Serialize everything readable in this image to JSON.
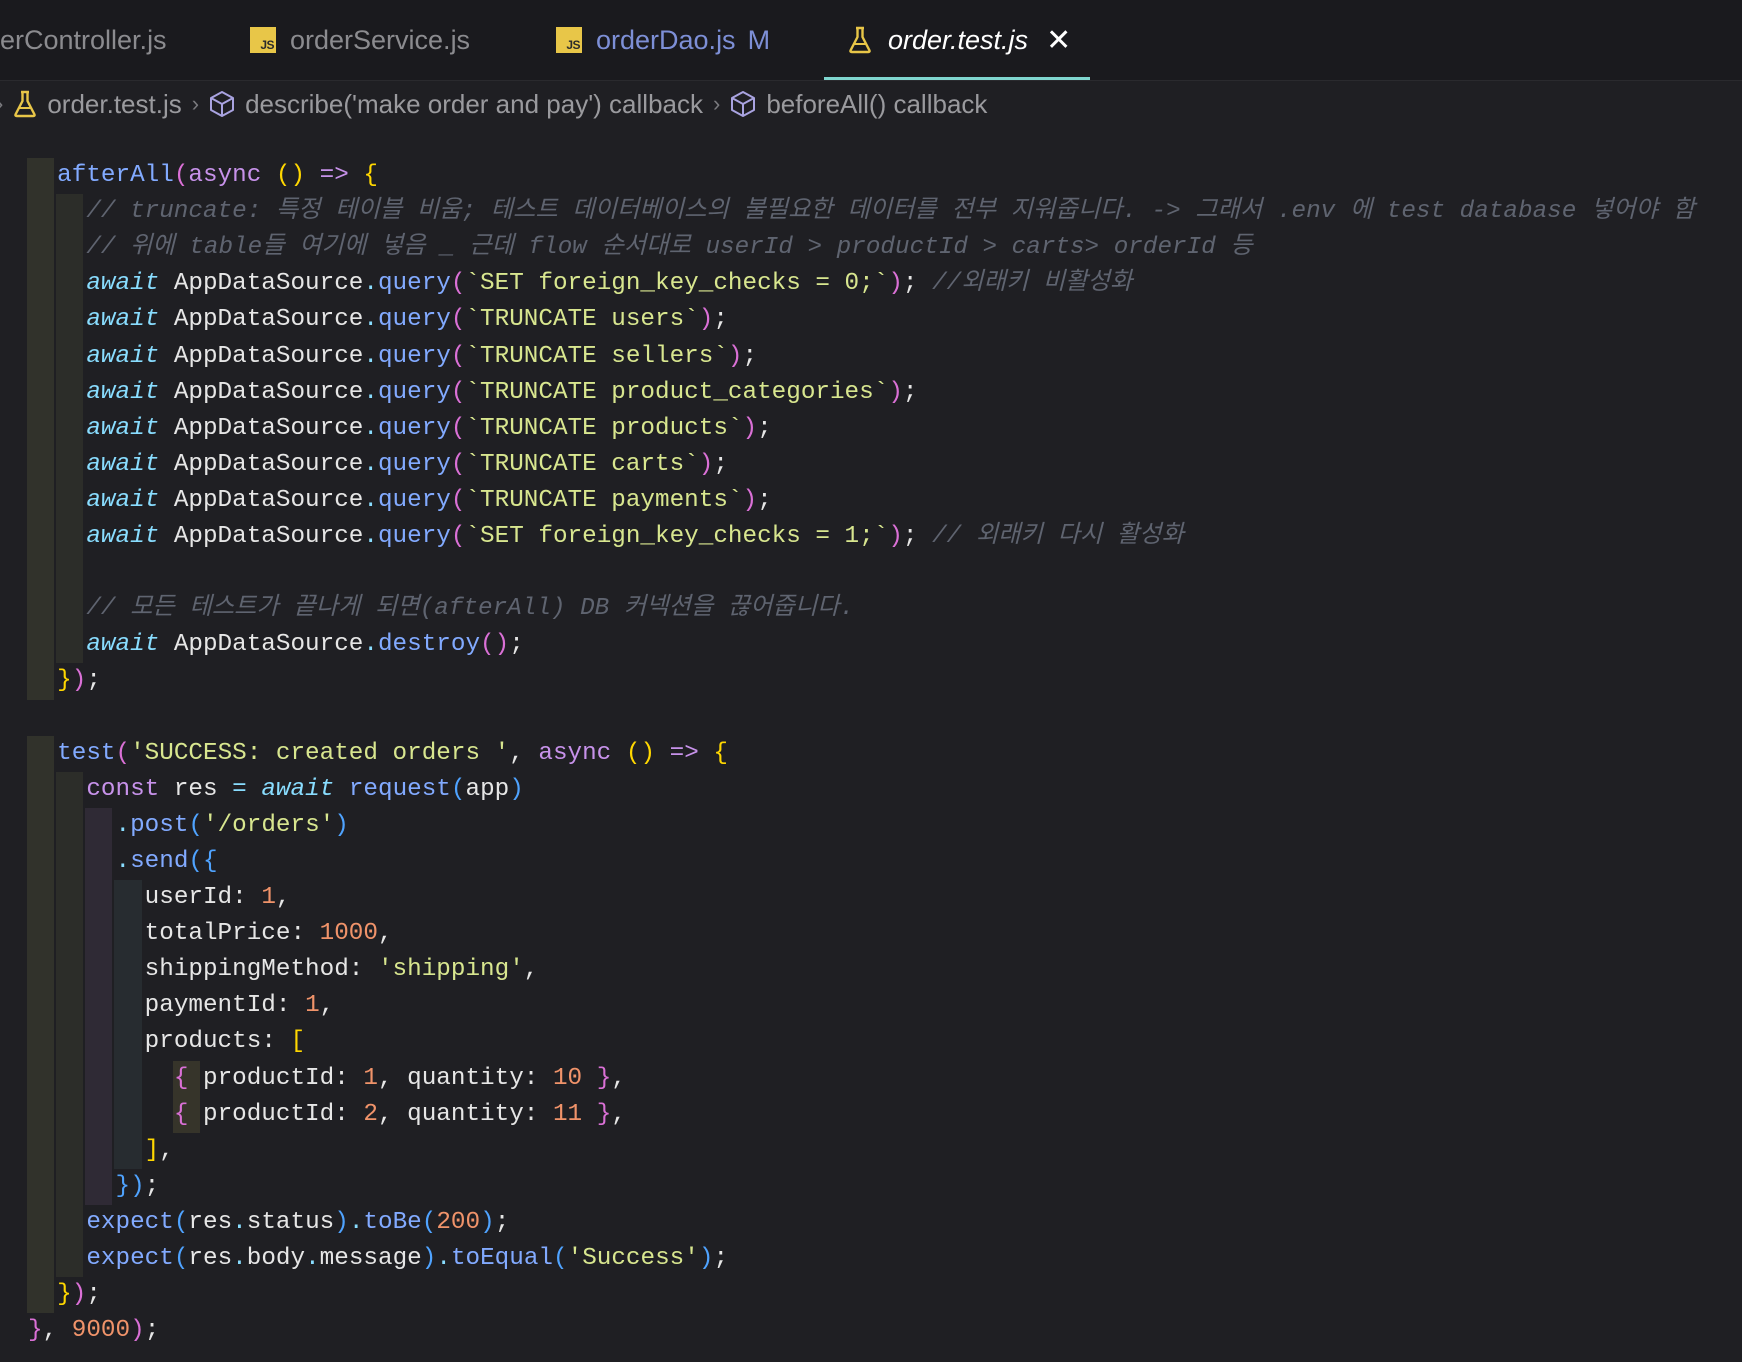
{
  "tabs": [
    {
      "label": "erController.js"
    },
    {
      "label": "orderService.js"
    },
    {
      "label": "orderDao.js",
      "badge": "M"
    },
    {
      "label": "order.test.js",
      "active": true
    }
  ],
  "breadcrumb": [
    "order.test.js",
    "describe('make order and pay') callback",
    "beforeAll() callback"
  ],
  "colors": {
    "accent": "#7fd6cf",
    "js_icon": "#e8c648",
    "modified": "#7d8fd6"
  },
  "code": [
    [
      [
        "  ",
        "id"
      ],
      [
        "afterAll",
        "fn"
      ],
      [
        "(",
        "p2"
      ],
      [
        "async",
        "kw"
      ],
      [
        " ",
        "id"
      ],
      [
        "()",
        "p1"
      ],
      [
        " => ",
        "kw"
      ],
      [
        "{",
        "p1"
      ]
    ],
    [
      [
        "    ",
        "id"
      ],
      [
        "// truncate: 특정 테이블 비움; 테스트 데이터베이스의 불필요한 데이터를 전부 지워줍니다. -> 그래서 .env 에 test database 넣어야 함",
        "cm"
      ]
    ],
    [
      [
        "    ",
        "id"
      ],
      [
        "// 위에 table들 여기에 넣음 _ 근데 flow 순서대로 userId > productId > carts> orderId 등",
        "cm"
      ]
    ],
    [
      [
        "    ",
        "id"
      ],
      [
        "await",
        "kwi"
      ],
      [
        " AppDataSource",
        "id"
      ],
      [
        ".",
        "op"
      ],
      [
        "query",
        "fn"
      ],
      [
        "(",
        "p2"
      ],
      [
        "`SET foreign_key_checks = 0;`",
        "str"
      ],
      [
        ")",
        "p2"
      ],
      [
        ";",
        "id"
      ],
      [
        " //외래키 비활성화",
        "cm"
      ]
    ],
    [
      [
        "    ",
        "id"
      ],
      [
        "await",
        "kwi"
      ],
      [
        " AppDataSource",
        "id"
      ],
      [
        ".",
        "op"
      ],
      [
        "query",
        "fn"
      ],
      [
        "(",
        "p2"
      ],
      [
        "`TRUNCATE users`",
        "str"
      ],
      [
        ")",
        "p2"
      ],
      [
        ";",
        "id"
      ]
    ],
    [
      [
        "    ",
        "id"
      ],
      [
        "await",
        "kwi"
      ],
      [
        " AppDataSource",
        "id"
      ],
      [
        ".",
        "op"
      ],
      [
        "query",
        "fn"
      ],
      [
        "(",
        "p2"
      ],
      [
        "`TRUNCATE sellers`",
        "str"
      ],
      [
        ")",
        "p2"
      ],
      [
        ";",
        "id"
      ]
    ],
    [
      [
        "    ",
        "id"
      ],
      [
        "await",
        "kwi"
      ],
      [
        " AppDataSource",
        "id"
      ],
      [
        ".",
        "op"
      ],
      [
        "query",
        "fn"
      ],
      [
        "(",
        "p2"
      ],
      [
        "`TRUNCATE product_categories`",
        "str"
      ],
      [
        ")",
        "p2"
      ],
      [
        ";",
        "id"
      ]
    ],
    [
      [
        "    ",
        "id"
      ],
      [
        "await",
        "kwi"
      ],
      [
        " AppDataSource",
        "id"
      ],
      [
        ".",
        "op"
      ],
      [
        "query",
        "fn"
      ],
      [
        "(",
        "p2"
      ],
      [
        "`TRUNCATE products`",
        "str"
      ],
      [
        ")",
        "p2"
      ],
      [
        ";",
        "id"
      ]
    ],
    [
      [
        "    ",
        "id"
      ],
      [
        "await",
        "kwi"
      ],
      [
        " AppDataSource",
        "id"
      ],
      [
        ".",
        "op"
      ],
      [
        "query",
        "fn"
      ],
      [
        "(",
        "p2"
      ],
      [
        "`TRUNCATE carts`",
        "str"
      ],
      [
        ")",
        "p2"
      ],
      [
        ";",
        "id"
      ]
    ],
    [
      [
        "    ",
        "id"
      ],
      [
        "await",
        "kwi"
      ],
      [
        " AppDataSource",
        "id"
      ],
      [
        ".",
        "op"
      ],
      [
        "query",
        "fn"
      ],
      [
        "(",
        "p2"
      ],
      [
        "`TRUNCATE payments`",
        "str"
      ],
      [
        ")",
        "p2"
      ],
      [
        ";",
        "id"
      ]
    ],
    [
      [
        "    ",
        "id"
      ],
      [
        "await",
        "kwi"
      ],
      [
        " AppDataSource",
        "id"
      ],
      [
        ".",
        "op"
      ],
      [
        "query",
        "fn"
      ],
      [
        "(",
        "p2"
      ],
      [
        "`SET foreign_key_checks = 1;`",
        "str"
      ],
      [
        ")",
        "p2"
      ],
      [
        ";",
        "id"
      ],
      [
        " // 외래키 다시 활성화",
        "cm"
      ]
    ],
    [],
    [
      [
        "    ",
        "id"
      ],
      [
        "// 모든 테스트가 끝나게 되면(afterAll) DB 커넥션을 끊어줍니다.",
        "cm"
      ]
    ],
    [
      [
        "    ",
        "id"
      ],
      [
        "await",
        "kwi"
      ],
      [
        " AppDataSource",
        "id"
      ],
      [
        ".",
        "op"
      ],
      [
        "destroy",
        "fn"
      ],
      [
        "()",
        "p2"
      ],
      [
        ";",
        "id"
      ]
    ],
    [
      [
        "  ",
        "id"
      ],
      [
        "}",
        "p1"
      ],
      [
        ")",
        "p2"
      ],
      [
        ";",
        "id"
      ]
    ],
    [],
    [
      [
        "  ",
        "id"
      ],
      [
        "test",
        "fn"
      ],
      [
        "(",
        "p2"
      ],
      [
        "'SUCCESS: created orders '",
        "str"
      ],
      [
        ", ",
        "id"
      ],
      [
        "async",
        "kw"
      ],
      [
        " ",
        "id"
      ],
      [
        "()",
        "p1"
      ],
      [
        " => ",
        "kw"
      ],
      [
        "{",
        "p1"
      ]
    ],
    [
      [
        "    ",
        "id"
      ],
      [
        "const",
        "kw"
      ],
      [
        " res ",
        "id"
      ],
      [
        "=",
        "op"
      ],
      [
        " ",
        "id"
      ],
      [
        "await",
        "kwi"
      ],
      [
        " ",
        "id"
      ],
      [
        "request",
        "fn"
      ],
      [
        "(",
        "p3"
      ],
      [
        "app",
        "id"
      ],
      [
        ")",
        "p3"
      ]
    ],
    [
      [
        "      ",
        "id"
      ],
      [
        ".",
        "op"
      ],
      [
        "post",
        "fn"
      ],
      [
        "(",
        "p3"
      ],
      [
        "'/orders'",
        "str"
      ],
      [
        ")",
        "p3"
      ]
    ],
    [
      [
        "      ",
        "id"
      ],
      [
        ".",
        "op"
      ],
      [
        "send",
        "fn"
      ],
      [
        "(",
        "p3"
      ],
      [
        "{",
        "p3"
      ]
    ],
    [
      [
        "        ",
        "id"
      ],
      [
        "userId",
        "id"
      ],
      [
        ": ",
        "id"
      ],
      [
        "1",
        "num"
      ],
      [
        ",",
        "id"
      ]
    ],
    [
      [
        "        ",
        "id"
      ],
      [
        "totalPrice",
        "id"
      ],
      [
        ": ",
        "id"
      ],
      [
        "1000",
        "num"
      ],
      [
        ",",
        "id"
      ]
    ],
    [
      [
        "        ",
        "id"
      ],
      [
        "shippingMethod",
        "id"
      ],
      [
        ": ",
        "id"
      ],
      [
        "'shipping'",
        "str"
      ],
      [
        ",",
        "id"
      ]
    ],
    [
      [
        "        ",
        "id"
      ],
      [
        "paymentId",
        "id"
      ],
      [
        ": ",
        "id"
      ],
      [
        "1",
        "num"
      ],
      [
        ",",
        "id"
      ]
    ],
    [
      [
        "        ",
        "id"
      ],
      [
        "products",
        "id"
      ],
      [
        ": ",
        "id"
      ],
      [
        "[",
        "p1"
      ]
    ],
    [
      [
        "          ",
        "id"
      ],
      [
        "{",
        "p2"
      ],
      [
        " productId",
        "id"
      ],
      [
        ": ",
        "id"
      ],
      [
        "1",
        "num"
      ],
      [
        ", quantity",
        "id"
      ],
      [
        ": ",
        "id"
      ],
      [
        "10",
        "num"
      ],
      [
        " ",
        "id"
      ],
      [
        "}",
        "p2"
      ],
      [
        ",",
        "id"
      ]
    ],
    [
      [
        "          ",
        "id"
      ],
      [
        "{",
        "p2"
      ],
      [
        " productId",
        "id"
      ],
      [
        ": ",
        "id"
      ],
      [
        "2",
        "num"
      ],
      [
        ", quantity",
        "id"
      ],
      [
        ": ",
        "id"
      ],
      [
        "11",
        "num"
      ],
      [
        " ",
        "id"
      ],
      [
        "}",
        "p2"
      ],
      [
        ",",
        "id"
      ]
    ],
    [
      [
        "        ",
        "id"
      ],
      [
        "]",
        "p1"
      ],
      [
        ",",
        "id"
      ]
    ],
    [
      [
        "      ",
        "id"
      ],
      [
        "}",
        "p3"
      ],
      [
        ")",
        "p3"
      ],
      [
        ";",
        "id"
      ]
    ],
    [
      [
        "    ",
        "id"
      ],
      [
        "expect",
        "fn"
      ],
      [
        "(",
        "p3"
      ],
      [
        "res",
        "id"
      ],
      [
        ".",
        "op"
      ],
      [
        "status",
        "id"
      ],
      [
        ")",
        "p3"
      ],
      [
        ".",
        "op"
      ],
      [
        "toBe",
        "fn"
      ],
      [
        "(",
        "p3"
      ],
      [
        "200",
        "num"
      ],
      [
        ")",
        "p3"
      ],
      [
        ";",
        "id"
      ]
    ],
    [
      [
        "    ",
        "id"
      ],
      [
        "expect",
        "fn"
      ],
      [
        "(",
        "p3"
      ],
      [
        "res",
        "id"
      ],
      [
        ".",
        "op"
      ],
      [
        "body",
        "id"
      ],
      [
        ".",
        "op"
      ],
      [
        "message",
        "id"
      ],
      [
        ")",
        "p3"
      ],
      [
        ".",
        "op"
      ],
      [
        "toEqual",
        "fn"
      ],
      [
        "(",
        "p3"
      ],
      [
        "'Success'",
        "str"
      ],
      [
        ")",
        "p3"
      ],
      [
        ";",
        "id"
      ]
    ],
    [
      [
        "  ",
        "id"
      ],
      [
        "}",
        "p1"
      ],
      [
        ")",
        "p2"
      ],
      [
        ";",
        "id"
      ]
    ],
    [
      [
        "",
        "id"
      ],
      [
        "}",
        "p2"
      ],
      [
        ", ",
        "id"
      ],
      [
        "9000",
        "num"
      ],
      [
        ")",
        "p2"
      ],
      [
        ";",
        "id"
      ]
    ]
  ]
}
